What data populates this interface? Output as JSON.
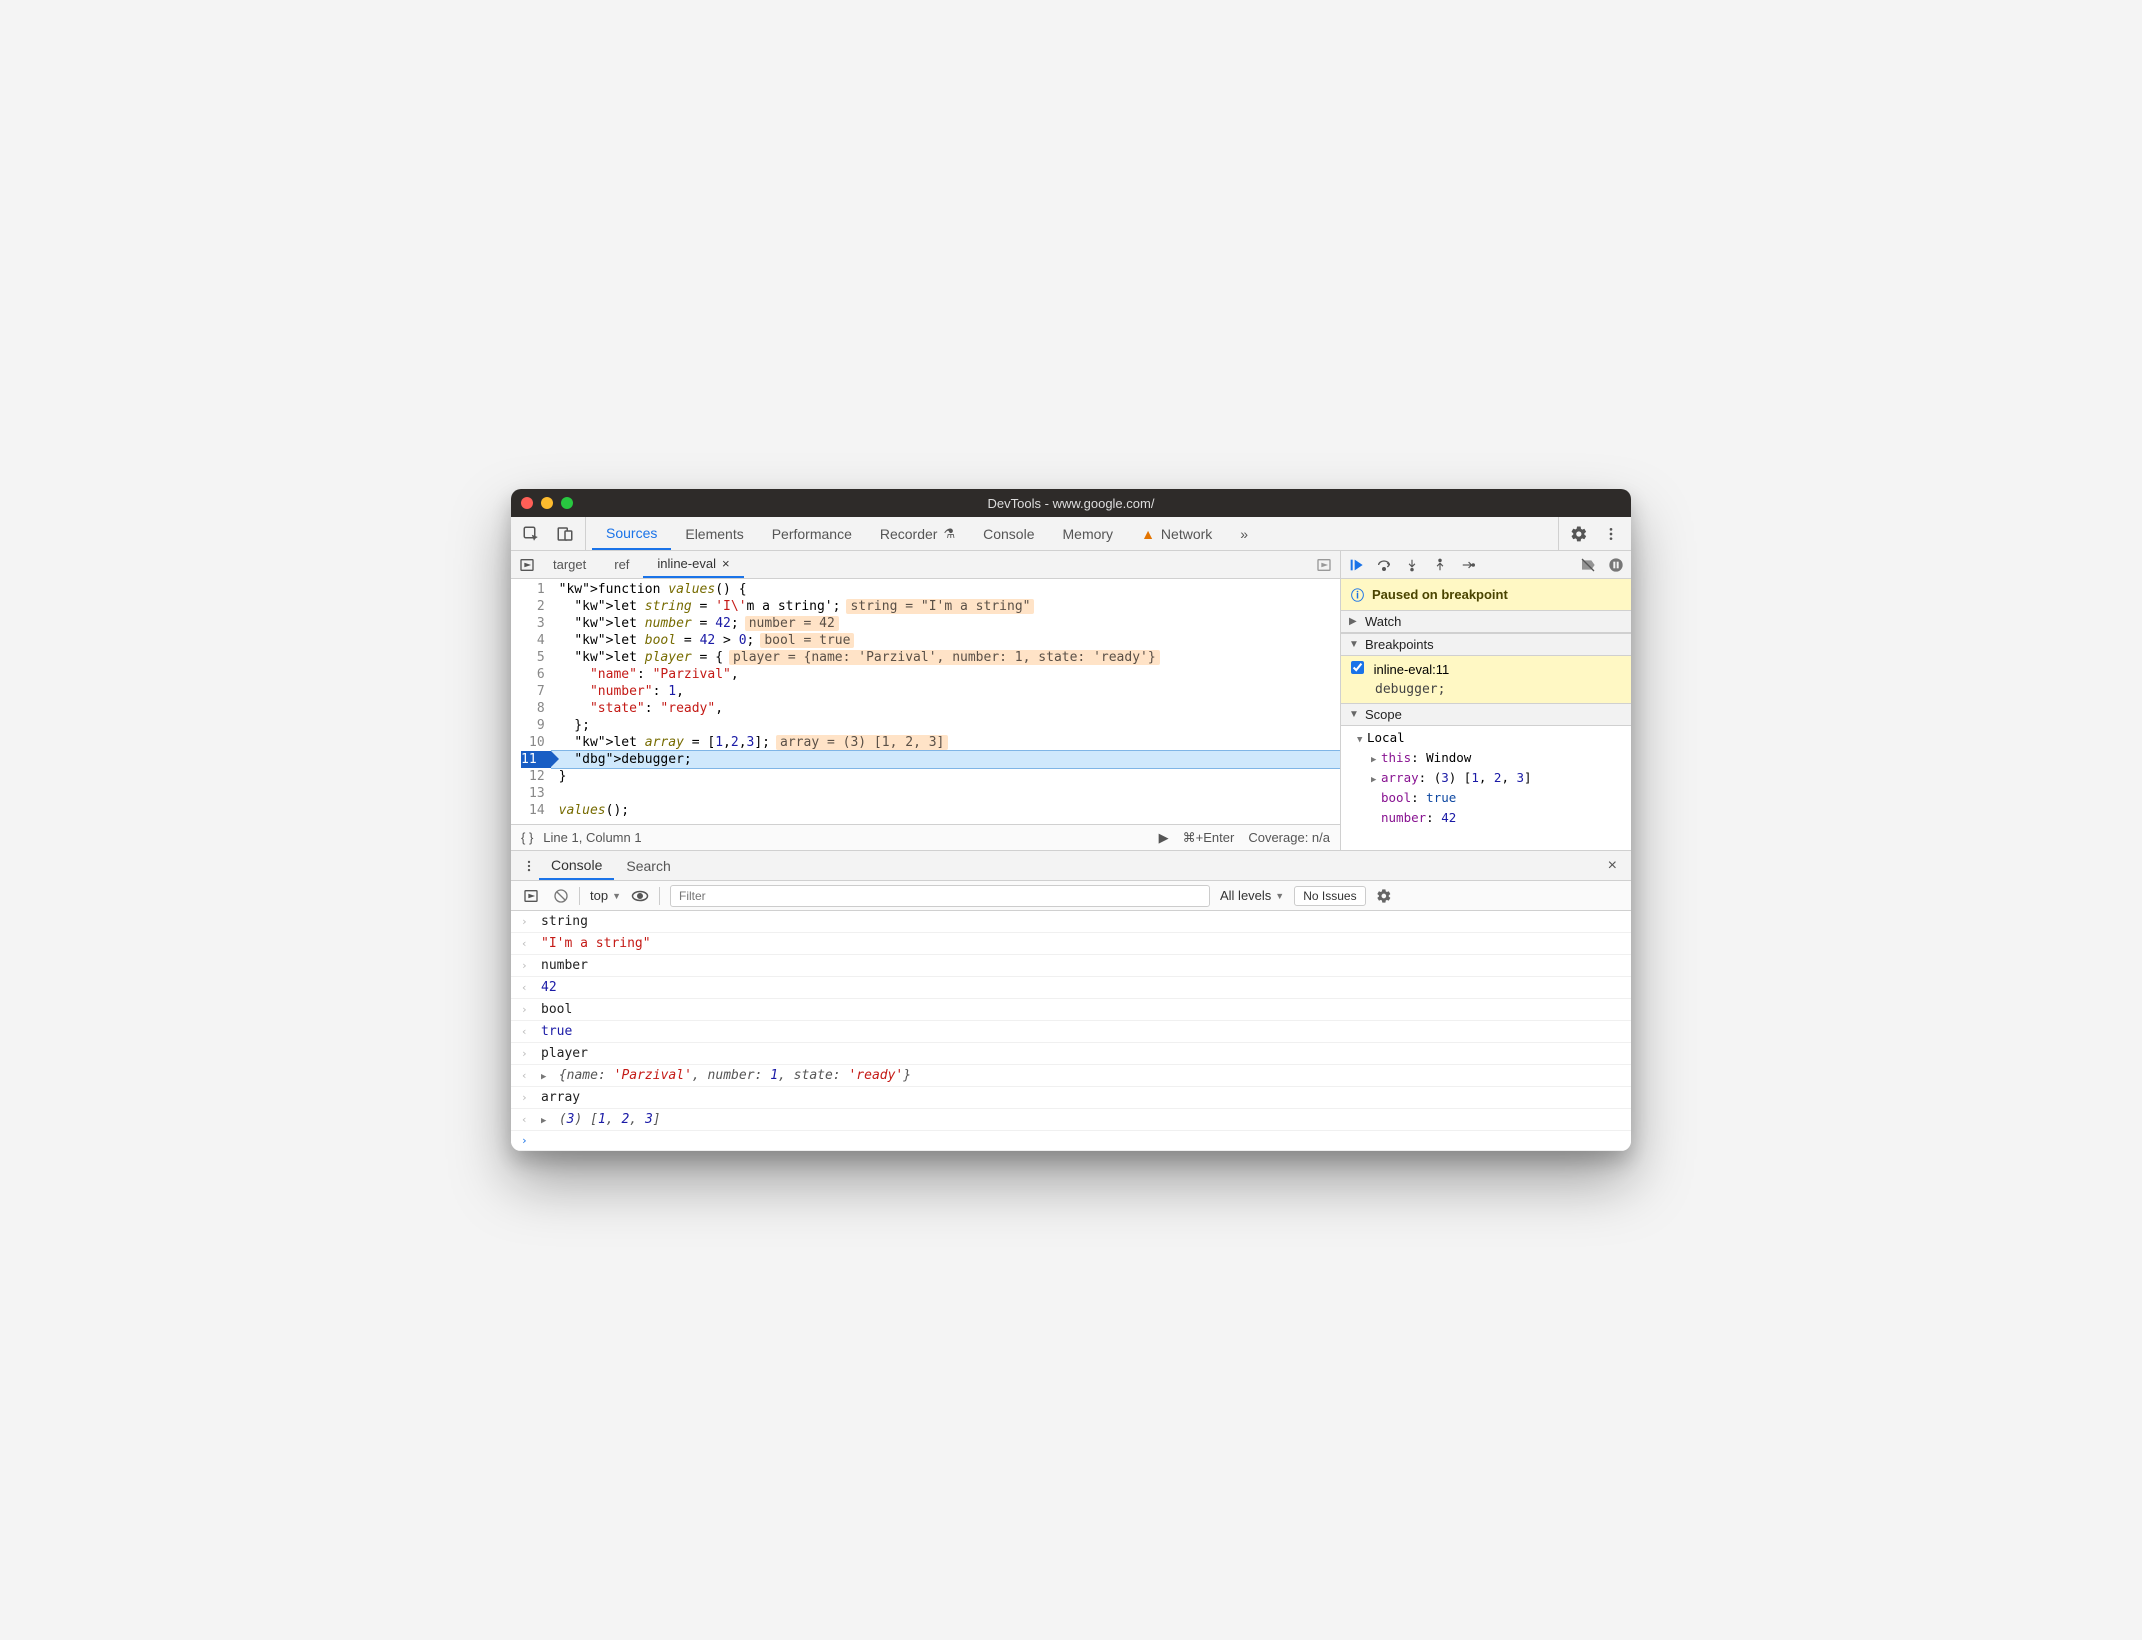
{
  "window": {
    "title": "DevTools - www.google.com/"
  },
  "tabs": {
    "items": [
      "Sources",
      "Elements",
      "Performance",
      "Recorder",
      "Console",
      "Memory",
      "Network"
    ],
    "active": "Sources",
    "flask_on": "Recorder",
    "warn_on": "Network"
  },
  "file_tabs": {
    "items": [
      "target",
      "ref",
      "inline-eval"
    ],
    "active": "inline-eval",
    "closable": "inline-eval"
  },
  "code": {
    "lines": [
      {
        "n": 1,
        "raw": "function values() {"
      },
      {
        "n": 2,
        "raw": "  let string = 'I\\'m a string';",
        "inline": "string = \"I'm a string\""
      },
      {
        "n": 3,
        "raw": "  let number = 42;",
        "inline": "number = 42"
      },
      {
        "n": 4,
        "raw": "  let bool = 42 > 0;",
        "inline": "bool = true"
      },
      {
        "n": 5,
        "raw": "  let player = {",
        "inline": "player = {name: 'Parzival', number: 1, state: 'ready'}"
      },
      {
        "n": 6,
        "raw": "    \"name\": \"Parzival\","
      },
      {
        "n": 7,
        "raw": "    \"number\": 1,"
      },
      {
        "n": 8,
        "raw": "    \"state\": \"ready\","
      },
      {
        "n": 9,
        "raw": "  };"
      },
      {
        "n": 10,
        "raw": "  let array = [1,2,3];",
        "inline": "array = (3) [1, 2, 3]"
      },
      {
        "n": 11,
        "raw": "  debugger;",
        "breakpoint": true,
        "current": true
      },
      {
        "n": 12,
        "raw": "}"
      },
      {
        "n": 13,
        "raw": ""
      },
      {
        "n": 14,
        "raw": "values();"
      }
    ]
  },
  "status": {
    "cursor": "Line 1, Column 1",
    "shortcut": "⌘+Enter",
    "coverage": "Coverage: n/a"
  },
  "debugger": {
    "paused_label": "Paused on breakpoint",
    "sections": {
      "watch": "Watch",
      "breakpoints": "Breakpoints",
      "scope": "Scope"
    },
    "breakpoints": [
      {
        "checked": true,
        "label": "inline-eval:11",
        "code": "debugger;"
      }
    ],
    "scope": {
      "group": "Local",
      "items": [
        {
          "key": "this",
          "value": "Window",
          "expandable": true
        },
        {
          "key": "array",
          "value": "(3) [1, 2, 3]",
          "expandable": true,
          "array": [
            1,
            2,
            3
          ]
        },
        {
          "key": "bool",
          "value": "true",
          "type": "bool"
        },
        {
          "key": "number",
          "value": "42",
          "type": "num"
        }
      ]
    }
  },
  "drawer": {
    "tabs": [
      "Console",
      "Search"
    ],
    "active": "Console",
    "context": "top",
    "filter_placeholder": "Filter",
    "levels": "All levels",
    "issues": "No Issues"
  },
  "console_log": [
    {
      "dir": "in",
      "text": "string"
    },
    {
      "dir": "out",
      "kind": "string",
      "text": "\"I'm a string\""
    },
    {
      "dir": "in",
      "text": "number"
    },
    {
      "dir": "out",
      "kind": "number",
      "text": "42"
    },
    {
      "dir": "in",
      "text": "bool"
    },
    {
      "dir": "out",
      "kind": "bool",
      "text": "true"
    },
    {
      "dir": "in",
      "text": "player"
    },
    {
      "dir": "out",
      "kind": "object",
      "text": "{name: 'Parzival', number: 1, state: 'ready'}"
    },
    {
      "dir": "in",
      "text": "array"
    },
    {
      "dir": "out",
      "kind": "array",
      "text": "(3) [1, 2, 3]"
    }
  ]
}
